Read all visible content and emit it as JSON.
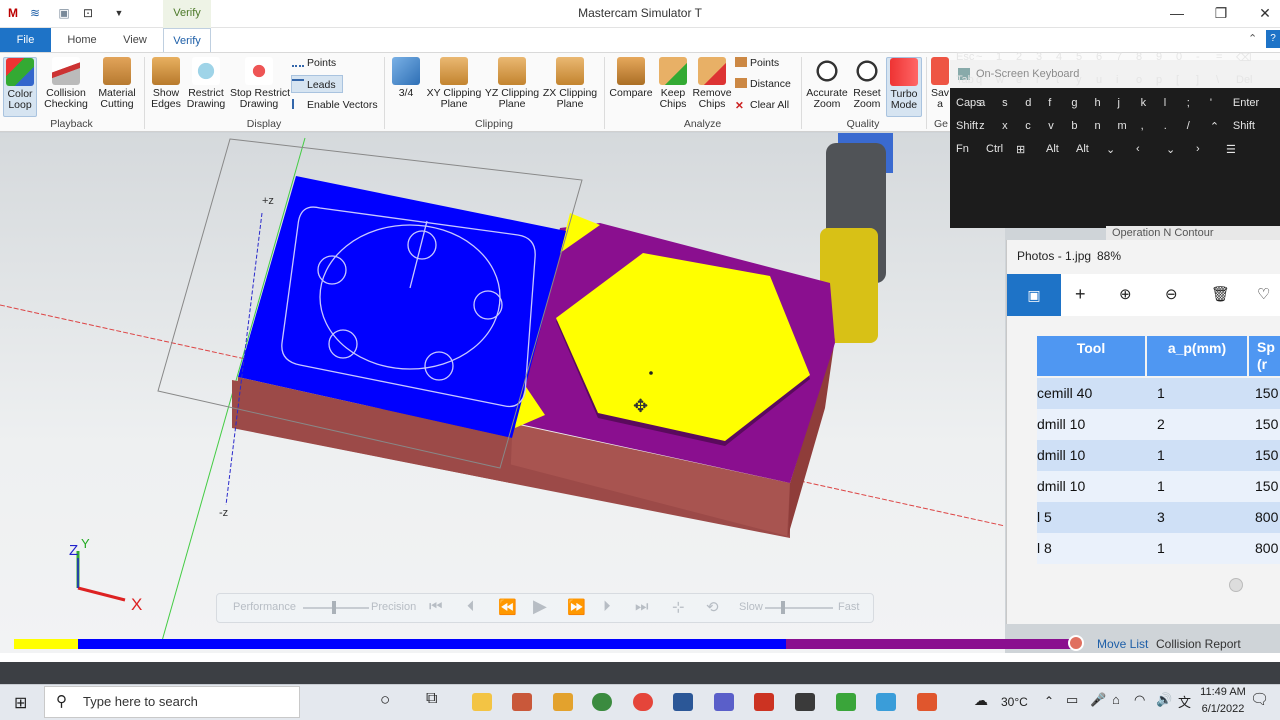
{
  "window": {
    "title": "Mastercam Simulator  T",
    "context_tab": "Verify"
  },
  "menu": {
    "file": "File",
    "home": "Home",
    "view": "View",
    "verify": "Verify"
  },
  "ribbon": {
    "playback": {
      "label": "Playback",
      "color_loop": "Color\nLoop",
      "collision": "Collision\nChecking",
      "material": "Material\nCutting"
    },
    "display": {
      "label": "Display",
      "show_edges": "Show\nEdges",
      "restrict": "Restrict\nDrawing",
      "stop_restrict": "Stop Restrict\nDrawing",
      "points": "Points",
      "leads": "Leads",
      "enable_vectors": "Enable Vectors"
    },
    "clipping": {
      "label": "Clipping",
      "three_quarter": "3/4",
      "xy": "XY Clipping\nPlane",
      "yz": "YZ Clipping\nPlane",
      "zx": "ZX Clipping\nPlane"
    },
    "analyze": {
      "label": "Analyze",
      "compare": "Compare",
      "keep_chips": "Keep\nChips",
      "remove_chips": "Remove\nChips",
      "points": "Points",
      "distance": "Distance",
      "clear_all": "Clear All"
    },
    "quality": {
      "label": "Quality",
      "accurate_zoom": "Accurate\nZoom",
      "reset_zoom": "Reset\nZoom",
      "turbo": "Turbo\nMode"
    },
    "partial": {
      "save": "Sav\na",
      "geo": "Ge"
    }
  },
  "viewport": {
    "plus_z": "+z",
    "minus_z": "-z",
    "axis_z": "Z",
    "axis_y": "Y",
    "axis_x": "X"
  },
  "playback": {
    "performance": "Performance",
    "precision": "Precision",
    "slow": "Slow",
    "fast": "Fast"
  },
  "keyboard": {
    "title": "On-Screen Keyboard",
    "rows": [
      [
        "Esc",
        "~",
        "1",
        "2",
        "3",
        "4",
        "5",
        "6",
        "7",
        "8",
        "9",
        "0",
        "-",
        "=",
        "⌫"
      ],
      [
        "Tab",
        "q",
        "w",
        "e",
        "r",
        "t",
        "y",
        "u",
        "i",
        "o",
        "p",
        "[",
        "]",
        "\\",
        "Del"
      ],
      [
        "Caps",
        "a",
        "s",
        "d",
        "f",
        "g",
        "h",
        "j",
        "k",
        "l",
        ";",
        "'",
        "Enter"
      ],
      [
        "Shift",
        "z",
        "x",
        "c",
        "v",
        "b",
        "n",
        "m",
        ",",
        ".",
        "/",
        "⌃",
        "Shift"
      ],
      [
        "Fn",
        "Ctrl",
        "⊞",
        "Alt",
        "Alt",
        "⌄",
        "‹",
        "⌄",
        "›",
        "☰"
      ]
    ]
  },
  "operation_partial": "Operation N  Contour",
  "photos": {
    "title": "Photos - 1.jpg",
    "zoom": "88%",
    "headers": [
      "Tool",
      "a_p(mm)",
      "Sp\n(r"
    ],
    "rows": [
      {
        "tool": "cemill 40",
        "ap": "1",
        "sp": "150"
      },
      {
        "tool": "dmill 10",
        "ap": "2",
        "sp": "150"
      },
      {
        "tool": "dmill 10",
        "ap": "1",
        "sp": "150"
      },
      {
        "tool": "dmill 10",
        "ap": "1",
        "sp": "150"
      },
      {
        "tool": "l 5",
        "ap": "3",
        "sp": "800"
      },
      {
        "tool": "l 8",
        "ap": "1",
        "sp": "800"
      }
    ]
  },
  "panel_tabs": {
    "move_list": "Move List",
    "collision_report": "Collision Report"
  },
  "taskbar": {
    "search_placeholder": "Type here to search",
    "temperature": "30°C",
    "time": "11:49 AM",
    "date": "6/1/2022"
  },
  "colors": {
    "accent": "#1e73c7",
    "stock_blue": "#0000ff",
    "stock_purple": "#8a0f8f",
    "stock_yellow": "#ffff00",
    "stock_brown": "#9c4a48",
    "progress": "#0000ff"
  }
}
